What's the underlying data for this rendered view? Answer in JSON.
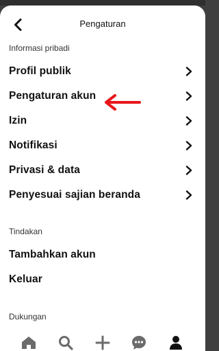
{
  "header": {
    "title": "Pengaturan",
    "back_icon": "chevron-left-icon"
  },
  "sections": {
    "personal_info": {
      "label": "Informasi pribadi",
      "items": [
        {
          "label": "Profil publik"
        },
        {
          "label": "Pengaturan akun"
        },
        {
          "label": "Izin"
        },
        {
          "label": "Notifikasi"
        },
        {
          "label": "Privasi & data"
        },
        {
          "label": "Penyesuai sajian beranda"
        }
      ]
    },
    "actions": {
      "label": "Tindakan",
      "items": [
        {
          "label": "Tambahkan akun"
        },
        {
          "label": "Keluar"
        }
      ]
    },
    "support": {
      "label": "Dukungan"
    }
  },
  "annotation": {
    "icon": "red-arrow-icon",
    "color": "#e8161b"
  },
  "bottom_nav": {
    "items": [
      "home-icon",
      "search-icon",
      "plus-icon",
      "chat-icon",
      "profile-icon"
    ]
  },
  "colors": {
    "text": "#111111",
    "background": "#ffffff"
  }
}
